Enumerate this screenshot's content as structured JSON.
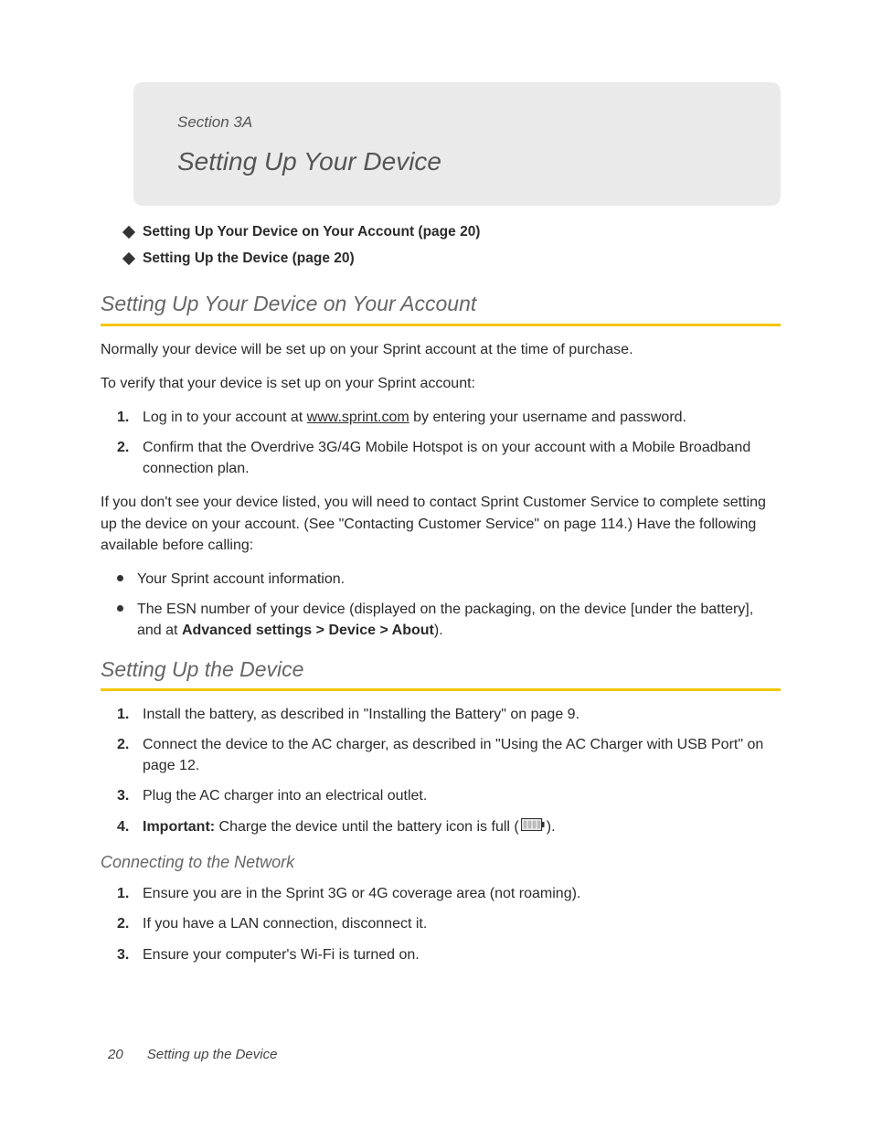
{
  "header": {
    "section_label": "Section 3A",
    "title": "Setting Up Your Device"
  },
  "toc": [
    "Setting Up Your Device on Your Account (page 20)",
    "Setting Up the Device (page 20)"
  ],
  "heading1": "Setting Up Your Device on Your Account",
  "para1": "Normally your device will be set up on your Sprint account at the time of purchase.",
  "para2": "To verify that your device is set up on your Sprint account:",
  "verify_steps": [
    {
      "pre": "Log in to your account at ",
      "link": "www.sprint.com",
      "post": " by entering your username and password."
    },
    {
      "text": "Confirm that the Overdrive 3G/4G Mobile Hotspot is on your account with a Mobile Broadband connection plan."
    }
  ],
  "para3": "If you don't see your device listed, you will need to contact Sprint Customer Service to complete setting up the device on your account. (See \"Contacting Customer Service\" on page 114.) Have the following available before calling:",
  "bullets": [
    {
      "text": "Your Sprint account information."
    },
    {
      "pre": "The ESN number of your device (displayed on the packaging, on the device [under the battery], and at ",
      "b1": "Advanced settings",
      "g1": " > ",
      "b2": "Device",
      "g2": " > ",
      "b3": "About",
      "post": ")."
    }
  ],
  "heading2": "Setting Up the Device",
  "setup_steps": [
    "Install the battery, as described in \"Installing the Battery\" on page 9.",
    "Connect the device to the AC charger, as described in \"Using the AC Charger with USB Port\" on page 12.",
    "Plug the AC charger into an electrical outlet."
  ],
  "setup_step4": {
    "important": "Important:",
    "pre": " Charge the device until the battery icon is full (",
    "post": ")."
  },
  "heading3": "Connecting to the Network",
  "network_steps": [
    "Ensure you are in the Sprint 3G or 4G coverage area (not roaming).",
    "If you have a LAN connection, disconnect it.",
    "Ensure your computer's Wi-Fi is turned on."
  ],
  "footer": {
    "page": "20",
    "title": "Setting up the Device"
  }
}
